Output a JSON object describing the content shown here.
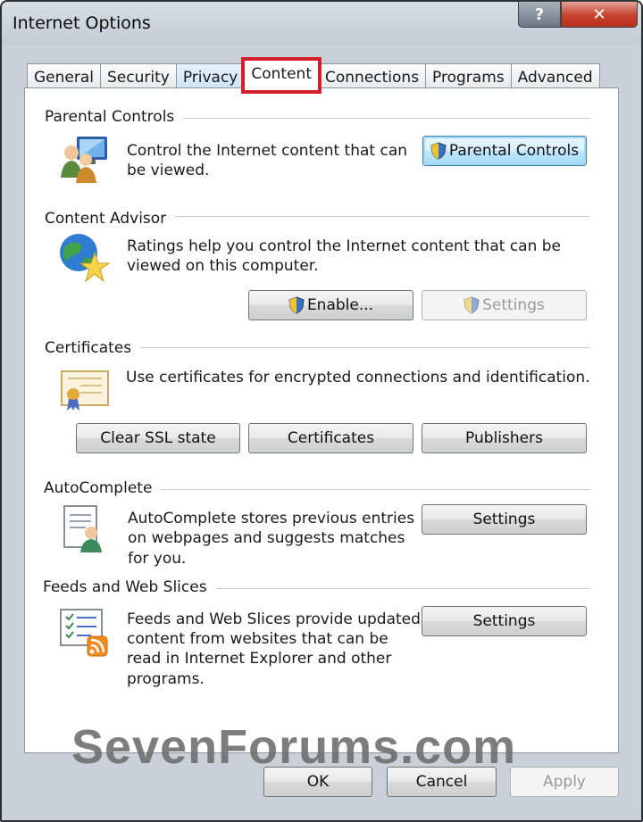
{
  "window": {
    "title": "Internet Options",
    "help_glyph": "?",
    "close_glyph": "✕"
  },
  "tabs": [
    {
      "label": "General"
    },
    {
      "label": "Security"
    },
    {
      "label": "Privacy"
    },
    {
      "label": "Content",
      "active": true
    },
    {
      "label": "Connections"
    },
    {
      "label": "Programs"
    },
    {
      "label": "Advanced"
    }
  ],
  "parental": {
    "title": "Parental Controls",
    "desc_line1": "Control the Internet content that can",
    "desc_line2": "be viewed.",
    "button": "Parental Controls"
  },
  "advisor": {
    "title": "Content Advisor",
    "desc_line1": "Ratings help you control the Internet content that can be",
    "desc_line2": "viewed on this computer.",
    "enable_button": "Enable...",
    "settings_button": "Settings"
  },
  "certificates": {
    "title": "Certificates",
    "desc": "Use certificates for encrypted connections and identification.",
    "clear_ssl_button": "Clear SSL state",
    "certificates_button": "Certificates",
    "publishers_button": "Publishers"
  },
  "autocomplete": {
    "title": "AutoComplete",
    "desc_line1": "AutoComplete stores previous entries",
    "desc_line2": "on webpages and suggests matches",
    "desc_line3": "for you.",
    "settings_button": "Settings"
  },
  "feeds": {
    "title": "Feeds and Web Slices",
    "desc_line1": "Feeds and Web Slices provide updated",
    "desc_line2": "content from websites that can be",
    "desc_line3": "read in Internet Explorer and other",
    "desc_line4": "programs.",
    "settings_button": "Settings"
  },
  "footer": {
    "ok": "OK",
    "cancel": "Cancel",
    "apply": "Apply"
  },
  "watermark": "SevenForums.com",
  "colors": {
    "highlight": "#d31f2a",
    "focus_border": "#3c7fb1"
  }
}
